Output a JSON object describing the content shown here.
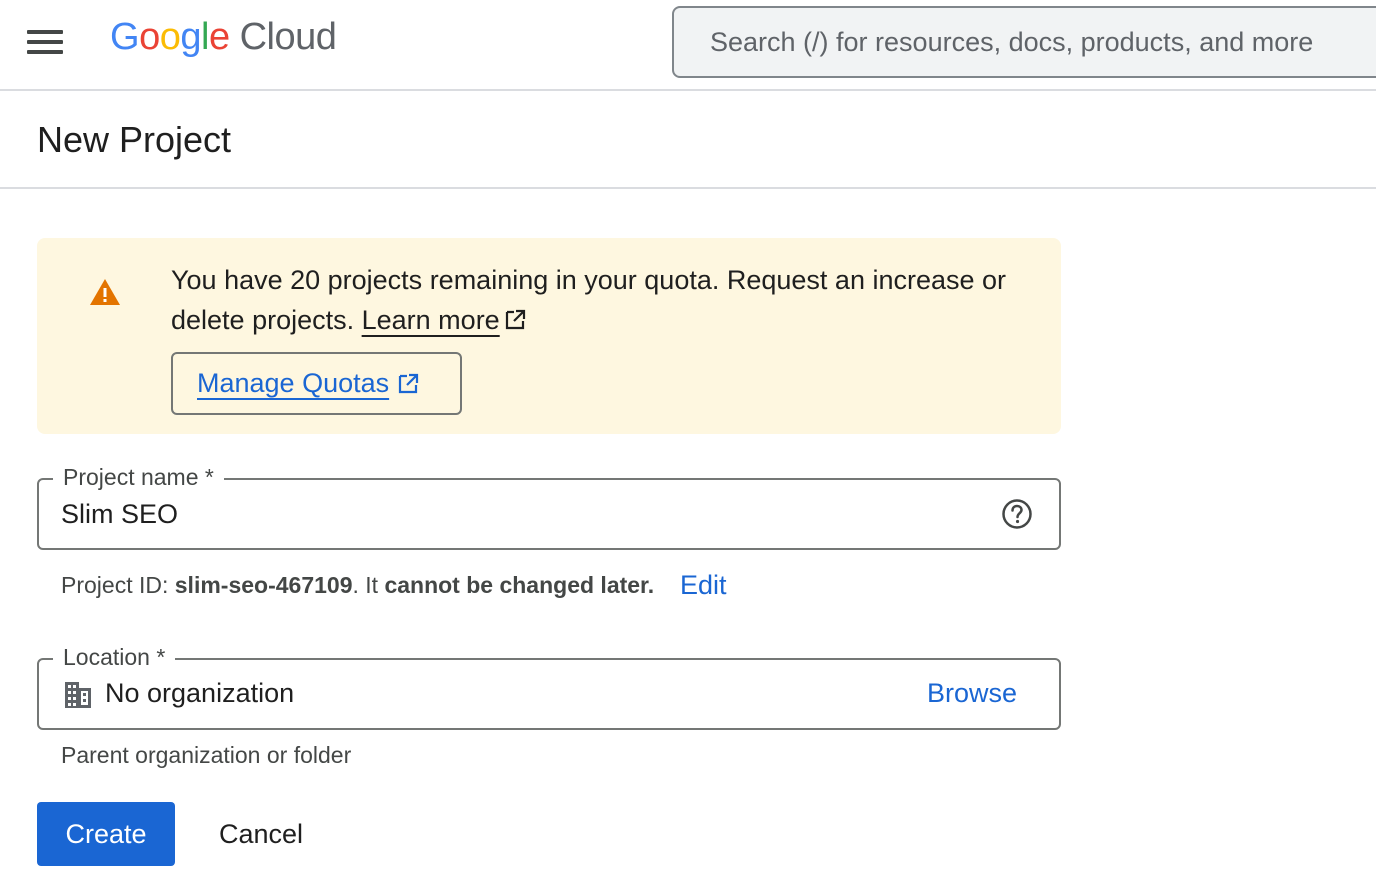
{
  "header": {
    "logo_google": [
      "G",
      "o",
      "o",
      "g",
      "l",
      "e"
    ],
    "logo_cloud": "Cloud",
    "search_placeholder": "Search (/) for resources, docs, products, and more"
  },
  "page": {
    "title": "New Project"
  },
  "banner": {
    "text": "You have 20 projects remaining in your quota. Request an increase or delete projects.",
    "learn_more": "Learn more",
    "manage_quotas": "Manage Quotas",
    "icon": "warning-icon",
    "color": "#fef7e0"
  },
  "project_name": {
    "label": "Project name *",
    "value": "Slim SEO"
  },
  "project_id": {
    "prefix": "Project ID: ",
    "id": "slim-seo-467109",
    "middle": ". It ",
    "note": "cannot be changed later.",
    "edit": "Edit"
  },
  "location": {
    "label": "Location *",
    "value": "No organization",
    "browse": "Browse",
    "helper": "Parent organization or folder"
  },
  "actions": {
    "create": "Create",
    "cancel": "Cancel"
  },
  "colors": {
    "accent": "#1a66d3",
    "warning": "#e37400"
  }
}
